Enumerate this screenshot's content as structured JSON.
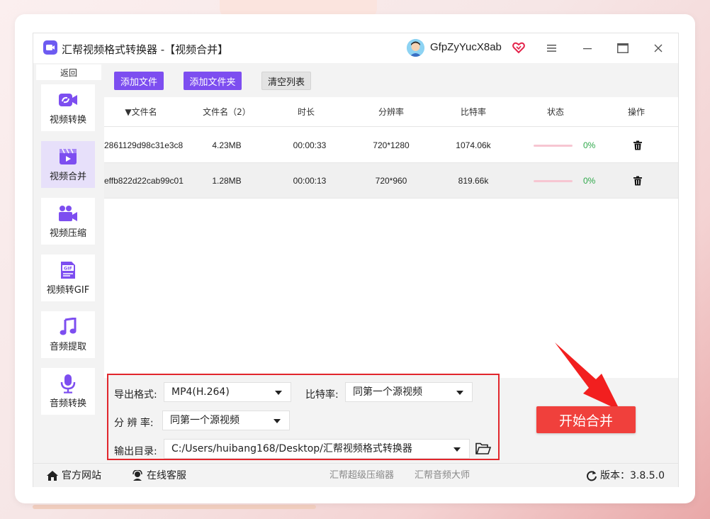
{
  "window": {
    "app_title": "汇帮视频格式转换器  -【视频合并】",
    "username": "GfpZyYucX8ab"
  },
  "sidebar": {
    "back_label": "返回",
    "items": [
      {
        "label": "视频转换",
        "icon": "video-convert-icon"
      },
      {
        "label": "视频合并",
        "icon": "video-merge-icon",
        "active": true
      },
      {
        "label": "视频压缩",
        "icon": "video-compress-icon"
      },
      {
        "label": "视频转GIF",
        "icon": "gif-icon"
      },
      {
        "label": "音频提取",
        "icon": "music-note-icon"
      },
      {
        "label": "音频转换",
        "icon": "microphone-icon"
      }
    ]
  },
  "toolbar": {
    "add_file": "添加文件",
    "add_folder": "添加文件夹",
    "clear_list": "清空列表"
  },
  "table": {
    "headers": [
      "▼文件名",
      "文件名（2）",
      "时长",
      "分辨率",
      "比特率",
      "状态",
      "操作"
    ],
    "rows": [
      {
        "name": "2861129d98c31e3c8",
        "size": "4.23MB",
        "duration": "00:00:33",
        "resolution": "720*1280",
        "bitrate": "1074.06k",
        "progress": 0,
        "percent": "0%"
      },
      {
        "name": "effb822d22cab99c01",
        "size": "1.28MB",
        "duration": "00:00:13",
        "resolution": "720*960",
        "bitrate": "819.66k",
        "progress": 0,
        "percent": "0%"
      }
    ]
  },
  "settings": {
    "format_label": "导出格式:",
    "format_value": "MP4(H.264)",
    "bitrate_label": "比特率:",
    "bitrate_value": "同第一个源视频",
    "resolution_label": "分 辨 率:",
    "resolution_value": "同第一个源视频",
    "output_label": "输出目录:",
    "output_value": "C:/Users/huibang168/Desktop/汇帮视频格式转换器"
  },
  "start_button": "开始合并",
  "statusbar": {
    "website": "官方网站",
    "support": "在线客服",
    "link1": "汇帮超级压缩器",
    "link2": "汇帮音频大师",
    "version": "版本：3.8.5.0"
  },
  "colors": {
    "accent_purple": "#7d4ef0",
    "start_red": "#f0403c",
    "highlight_red": "#e1262c",
    "success_green": "#2ea84a"
  }
}
